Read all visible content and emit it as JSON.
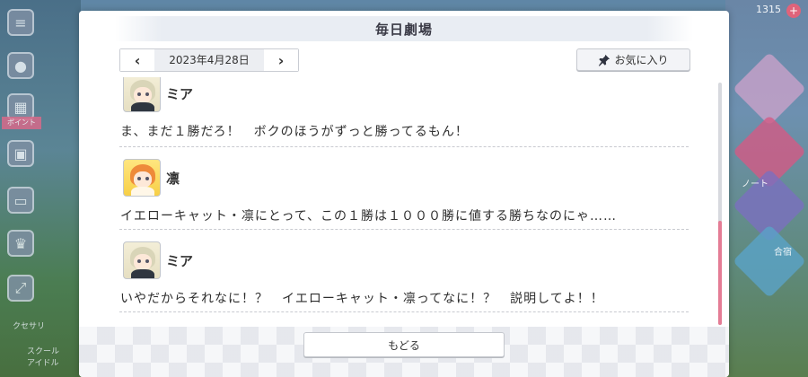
{
  "dialog": {
    "title": "毎日劇場",
    "date": "2023年4月28日",
    "prev_icon": "‹",
    "next_icon": "›",
    "favorite_label": "お気に入り",
    "back_label": "もどる"
  },
  "messages": [
    {
      "speaker": "ミア",
      "avatar": "mia",
      "text": "ま、まだ１勝だろ！　ボクのほうがずっと勝ってるもん！"
    },
    {
      "speaker": "凛",
      "avatar": "rin",
      "text": "イエローキャット・凛にとって、この１勝は１０００勝に値する勝ちなのにゃ……"
    },
    {
      "speaker": "ミア",
      "avatar": "mia",
      "text": "いやだからそれなに！？　イエローキャット・凛ってなに！？　説明してよ！！"
    }
  ],
  "background": {
    "event_badge": "ボイント",
    "left_labels": [
      "クセサリ",
      "スクール\nアイドル"
    ],
    "right_labels": [
      "ノート",
      "合宿"
    ],
    "coin_text": "1315",
    "colors": {
      "accent_pink": "#e47c95",
      "title_bar": "#e9edf3"
    }
  }
}
